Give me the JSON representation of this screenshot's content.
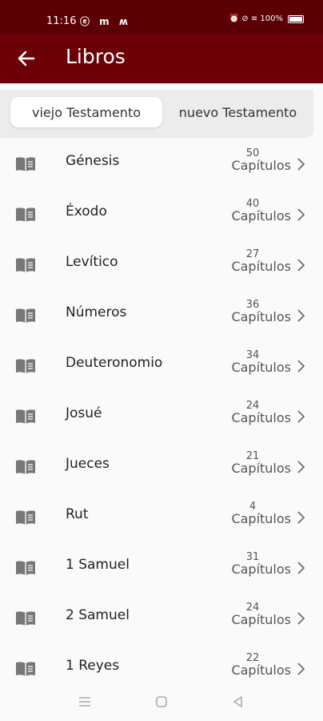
{
  "status": {
    "time": "11:16",
    "left_icons": "ⓔ m ʍ",
    "right_text": "⏰ ⊘ ≡ 100%"
  },
  "header": {
    "title": "Libros"
  },
  "tabs": [
    {
      "label": "viejo Testamento",
      "active": true
    },
    {
      "label": "nuevo Testamento",
      "active": false
    }
  ],
  "books": [
    {
      "name": "Génesis",
      "chapters": "50",
      "unit": "Capítulos"
    },
    {
      "name": "Éxodo",
      "chapters": "40",
      "unit": "Capítulos"
    },
    {
      "name": "Levítico",
      "chapters": "27",
      "unit": "Capítulos"
    },
    {
      "name": "Números",
      "chapters": "36",
      "unit": "Capítulos"
    },
    {
      "name": "Deuteronomio",
      "chapters": "34",
      "unit": "Capítulos"
    },
    {
      "name": "Josué",
      "chapters": "24",
      "unit": "Capítulos"
    },
    {
      "name": "Jueces",
      "chapters": "21",
      "unit": "Capítulos"
    },
    {
      "name": "Rut",
      "chapters": "4",
      "unit": "Capítulos"
    },
    {
      "name": "1 Samuel",
      "chapters": "31",
      "unit": "Capítulos"
    },
    {
      "name": "2 Samuel",
      "chapters": "24",
      "unit": "Capítulos"
    },
    {
      "name": "1 Reyes",
      "chapters": "22",
      "unit": "Capítulos"
    }
  ],
  "colors": {
    "status_bar": "#5a0004",
    "app_bar": "#6d0007"
  },
  "icons": {
    "book": "book-open-icon",
    "chevron": "chevron-right-icon",
    "back": "arrow-left-icon"
  }
}
